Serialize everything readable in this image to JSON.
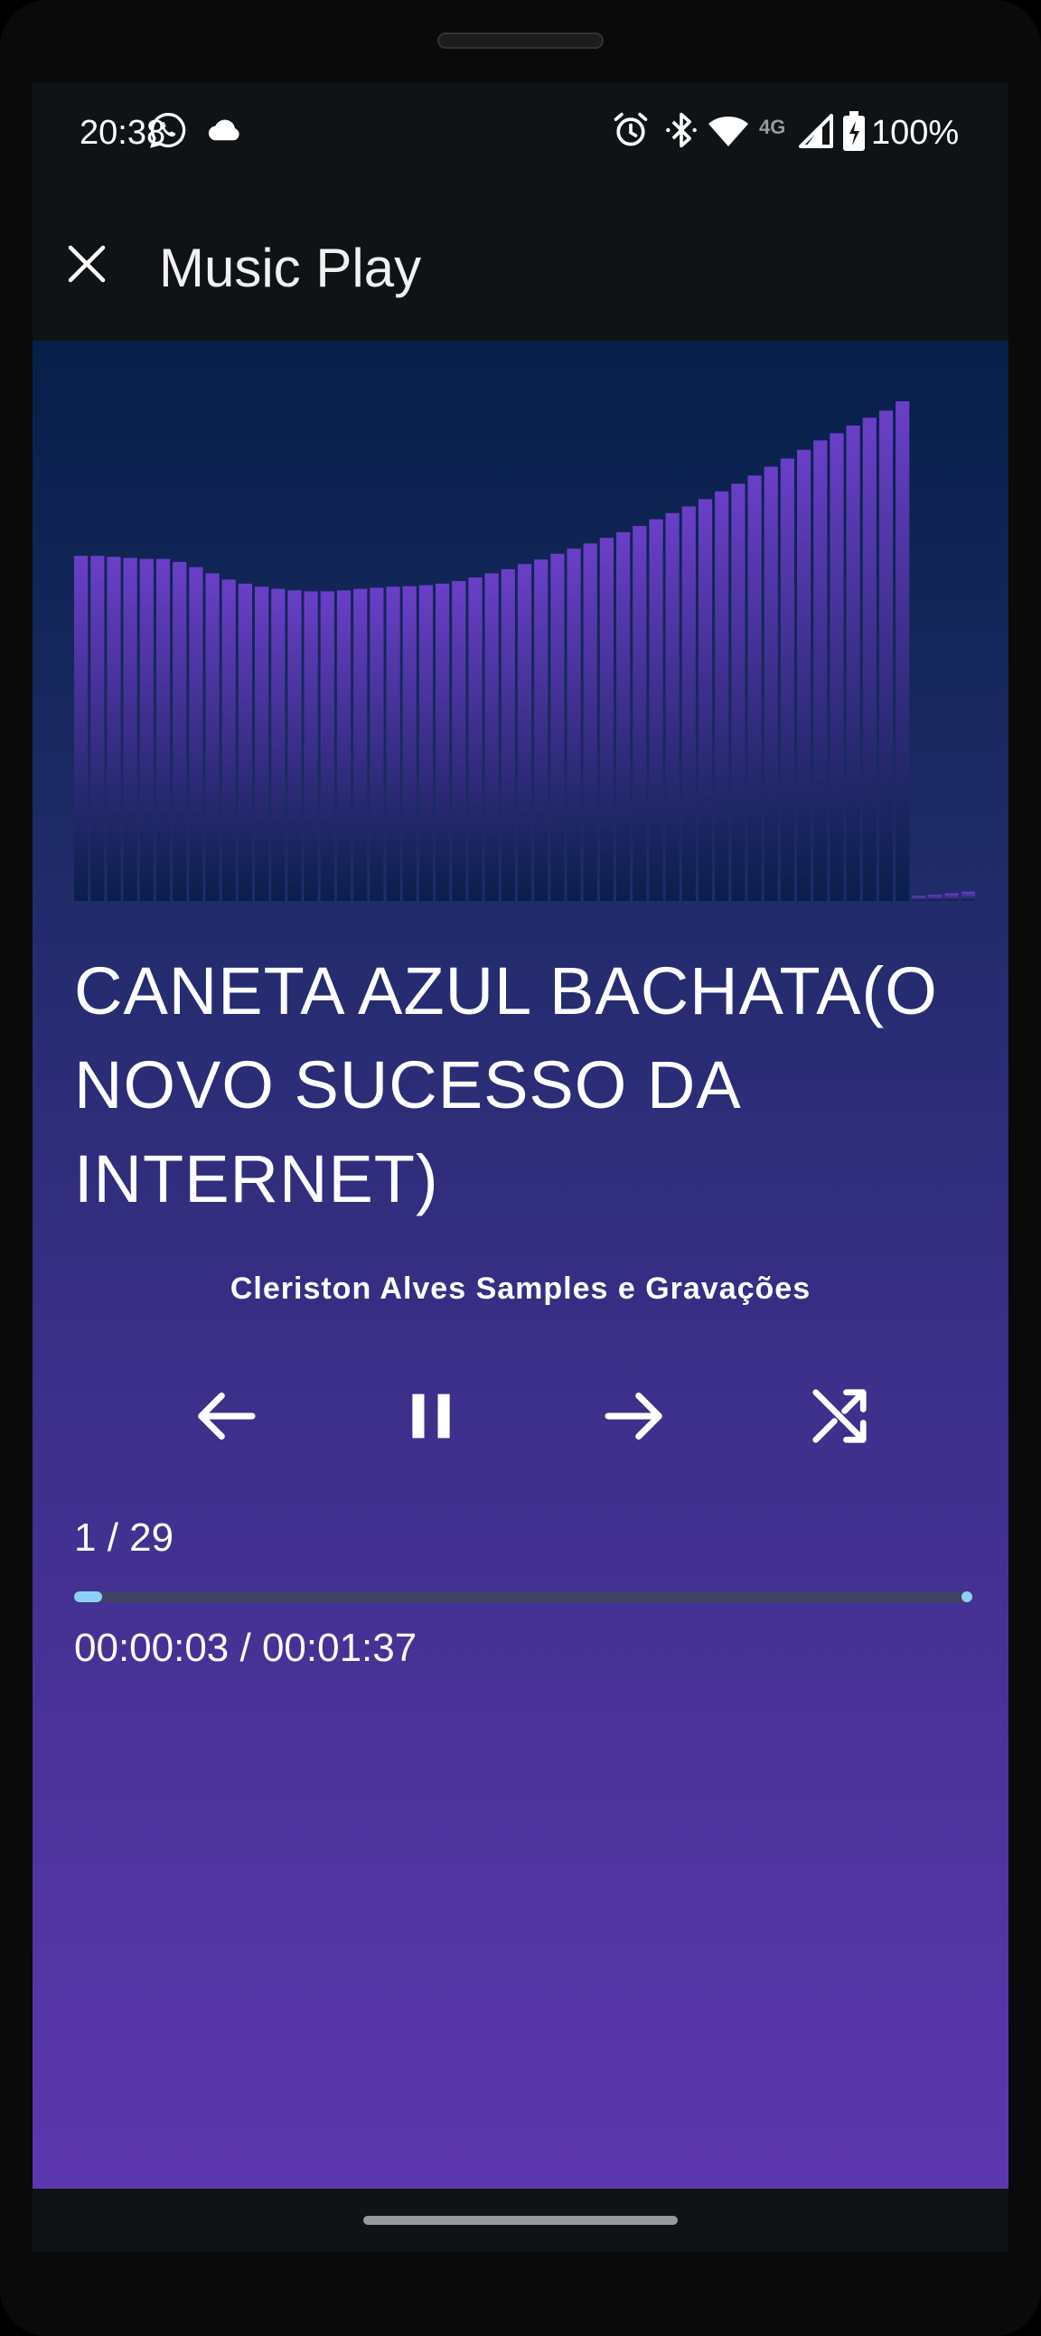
{
  "status_bar": {
    "time": "20:38",
    "battery": "100%",
    "network": "4G",
    "icons": [
      "whatsapp-icon",
      "cloud-icon",
      "alarm-icon",
      "bluetooth-icon",
      "wifi-icon",
      "signal-icon",
      "battery-charging-icon"
    ]
  },
  "app_bar": {
    "title": "Music Play",
    "close_icon": "close-icon"
  },
  "visualizer": {
    "bar_color": "#6a3fc8",
    "levels": [
      0.67,
      0.67,
      0.668,
      0.666,
      0.664,
      0.664,
      0.658,
      0.648,
      0.636,
      0.624,
      0.616,
      0.61,
      0.606,
      0.603,
      0.601,
      0.601,
      0.603,
      0.606,
      0.608,
      0.61,
      0.611,
      0.613,
      0.616,
      0.621,
      0.628,
      0.636,
      0.644,
      0.654,
      0.663,
      0.674,
      0.684,
      0.694,
      0.705,
      0.716,
      0.728,
      0.741,
      0.753,
      0.766,
      0.78,
      0.795,
      0.81,
      0.826,
      0.843,
      0.859,
      0.876,
      0.894,
      0.908,
      0.923,
      0.938,
      0.952,
      0.97,
      0.01,
      0.012,
      0.015,
      0.018
    ]
  },
  "track": {
    "title": "CANETA AZUL BACHATA(O NOVO SUCESSO DA INTERNET)",
    "artist": "Cleriston Alves Samples e Gravações",
    "position": "1 / 29",
    "time": "00:00:03 / 00:01:37",
    "progress": 0.031
  },
  "controls": {
    "previous_icon": "arrow-left-icon",
    "pause_icon": "pause-icon",
    "next_icon": "arrow-right-icon",
    "shuffle_icon": "shuffle-icon"
  },
  "colors": {
    "accent": "#8dd0f5",
    "progress_track": "#3e4366",
    "bg_top": "#061f48",
    "bg_bottom": "#5d37ae"
  }
}
